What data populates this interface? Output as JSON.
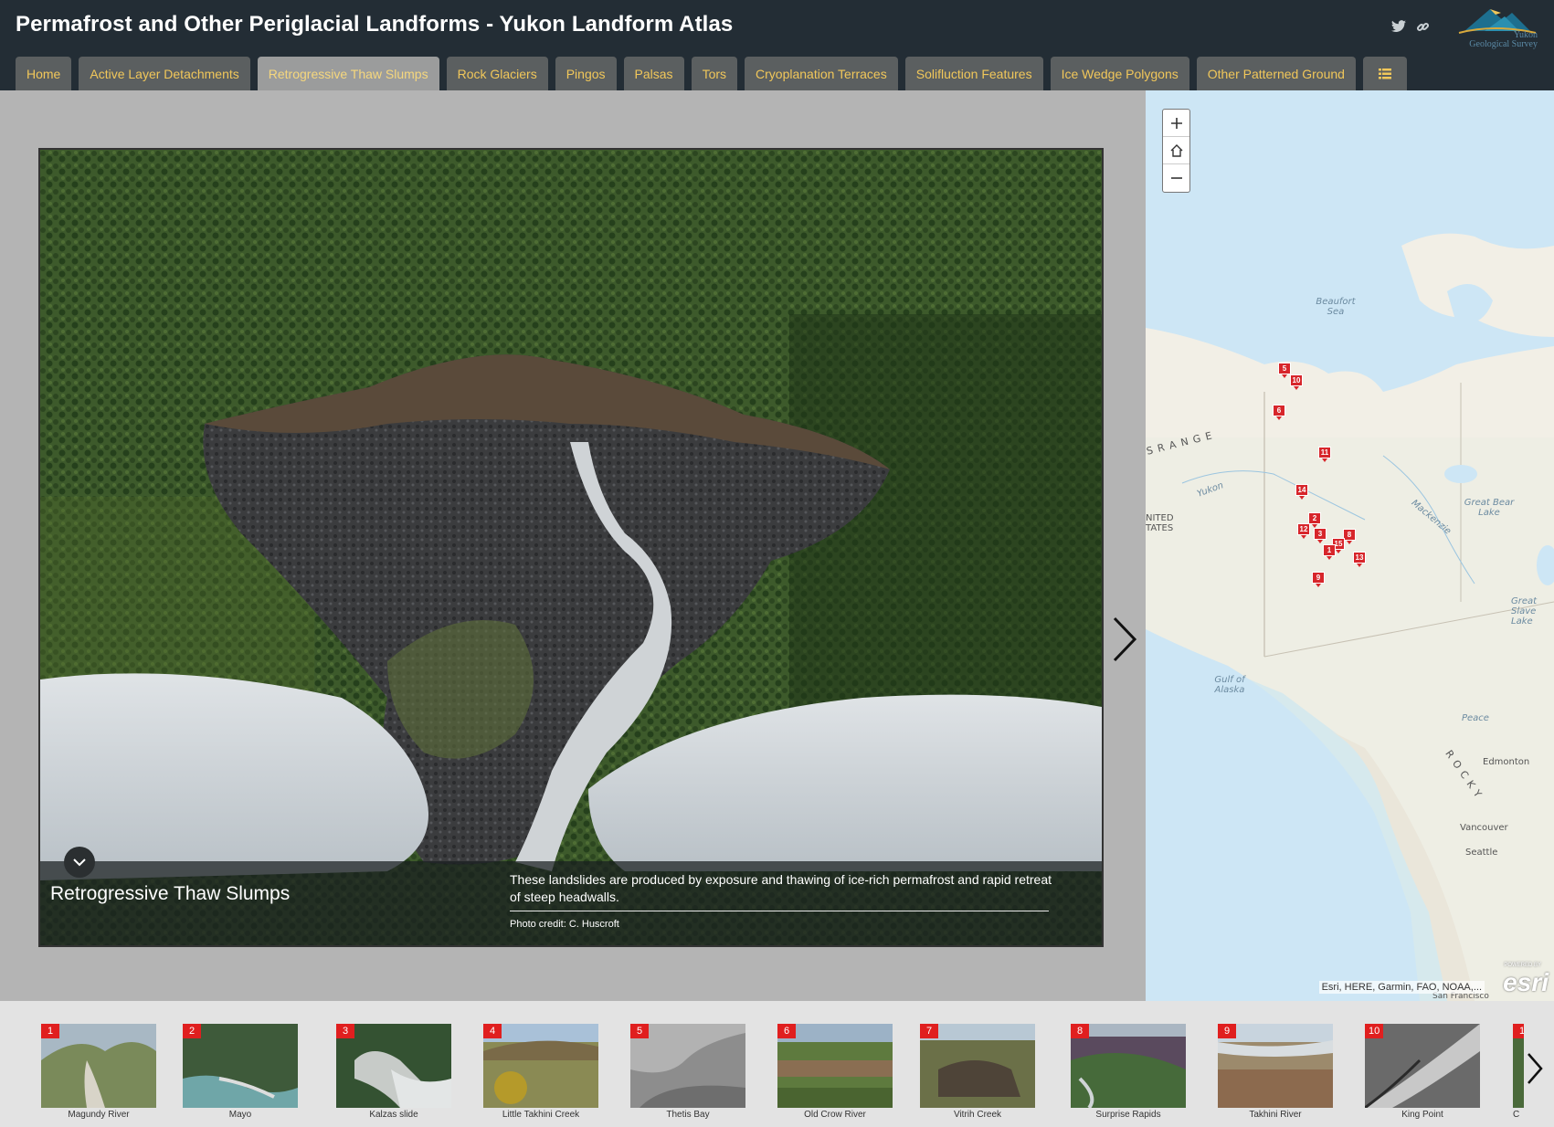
{
  "header": {
    "title": "Permafrost and Other Periglacial Landforms - Yukon Landform Atlas",
    "logo_text_line1": "Yukon",
    "logo_text_line2": "Geological Survey"
  },
  "tabs": [
    {
      "label": "Home"
    },
    {
      "label": "Active Layer Detachments"
    },
    {
      "label": "Retrogressive Thaw Slumps",
      "active": true
    },
    {
      "label": "Rock Glaciers"
    },
    {
      "label": "Pingos"
    },
    {
      "label": "Palsas"
    },
    {
      "label": "Tors"
    },
    {
      "label": "Cryoplanation Terraces"
    },
    {
      "label": "Solifluction Features"
    },
    {
      "label": "Ice Wedge Polygons"
    },
    {
      "label": "Other Patterned Ground"
    }
  ],
  "caption": {
    "title": "Retrogressive Thaw Slumps",
    "text": "These landslides are produced by exposure and thawing of ice-rich permafrost and rapid retreat of steep headwalls.",
    "credit": "Photo credit: C. Huscroft"
  },
  "map": {
    "labels": {
      "beaufort_sea": "Beaufort Sea",
      "range": "S  R  A  N  G  E",
      "yukon": "Yukon",
      "united_states": "NITED TATES",
      "great_bear_lake": "Great Bear Lake",
      "mackenzie": "Mackenzie",
      "gulf_of_alaska": "Gulf of Alaska",
      "peace": "Peace",
      "rocky": "R  O  C  K  Y",
      "edmonton": "Edmonton",
      "vancouver": "Vancouver",
      "seattle": "Seattle",
      "san_francisco": "San Francisco",
      "great_slave": "Great Slave Lake"
    },
    "attribution": "Esri, HERE, Garmin, FAO, NOAA,...",
    "esri_logo": "esri",
    "esri_powered": "POWERED BY",
    "pins": [
      "5",
      "10",
      "6",
      "11",
      "14",
      "2",
      "12",
      "3",
      "8",
      "15",
      "1",
      "13",
      "9"
    ]
  },
  "thumbnails": [
    {
      "num": "1",
      "label": "Magundy River"
    },
    {
      "num": "2",
      "label": "Mayo"
    },
    {
      "num": "3",
      "label": "Kalzas slide"
    },
    {
      "num": "4",
      "label": "Little Takhini Creek"
    },
    {
      "num": "5",
      "label": "Thetis Bay"
    },
    {
      "num": "6",
      "label": "Old Crow River"
    },
    {
      "num": "7",
      "label": "Vitrih Creek"
    },
    {
      "num": "8",
      "label": "Surprise Rapids"
    },
    {
      "num": "9",
      "label": "Takhini River"
    },
    {
      "num": "10",
      "label": "King Point"
    },
    {
      "num": "1",
      "label": "C"
    }
  ],
  "colors": {
    "header_bg": "#232d35",
    "tab_bg": "#5b5f60",
    "tab_active_bg": "#9b9c9c",
    "tab_text": "#f1c75a",
    "pin_red": "#d7262b",
    "thumb_badge": "#e01f1f"
  },
  "icons": {
    "share": [
      "twitter-icon",
      "link-icon"
    ],
    "tab_menu": "list-icon",
    "zoom": [
      "plus-icon",
      "home-icon",
      "minus-icon"
    ],
    "caption_toggle": "chevron-down-icon",
    "nav": "chevron-right-icon"
  }
}
